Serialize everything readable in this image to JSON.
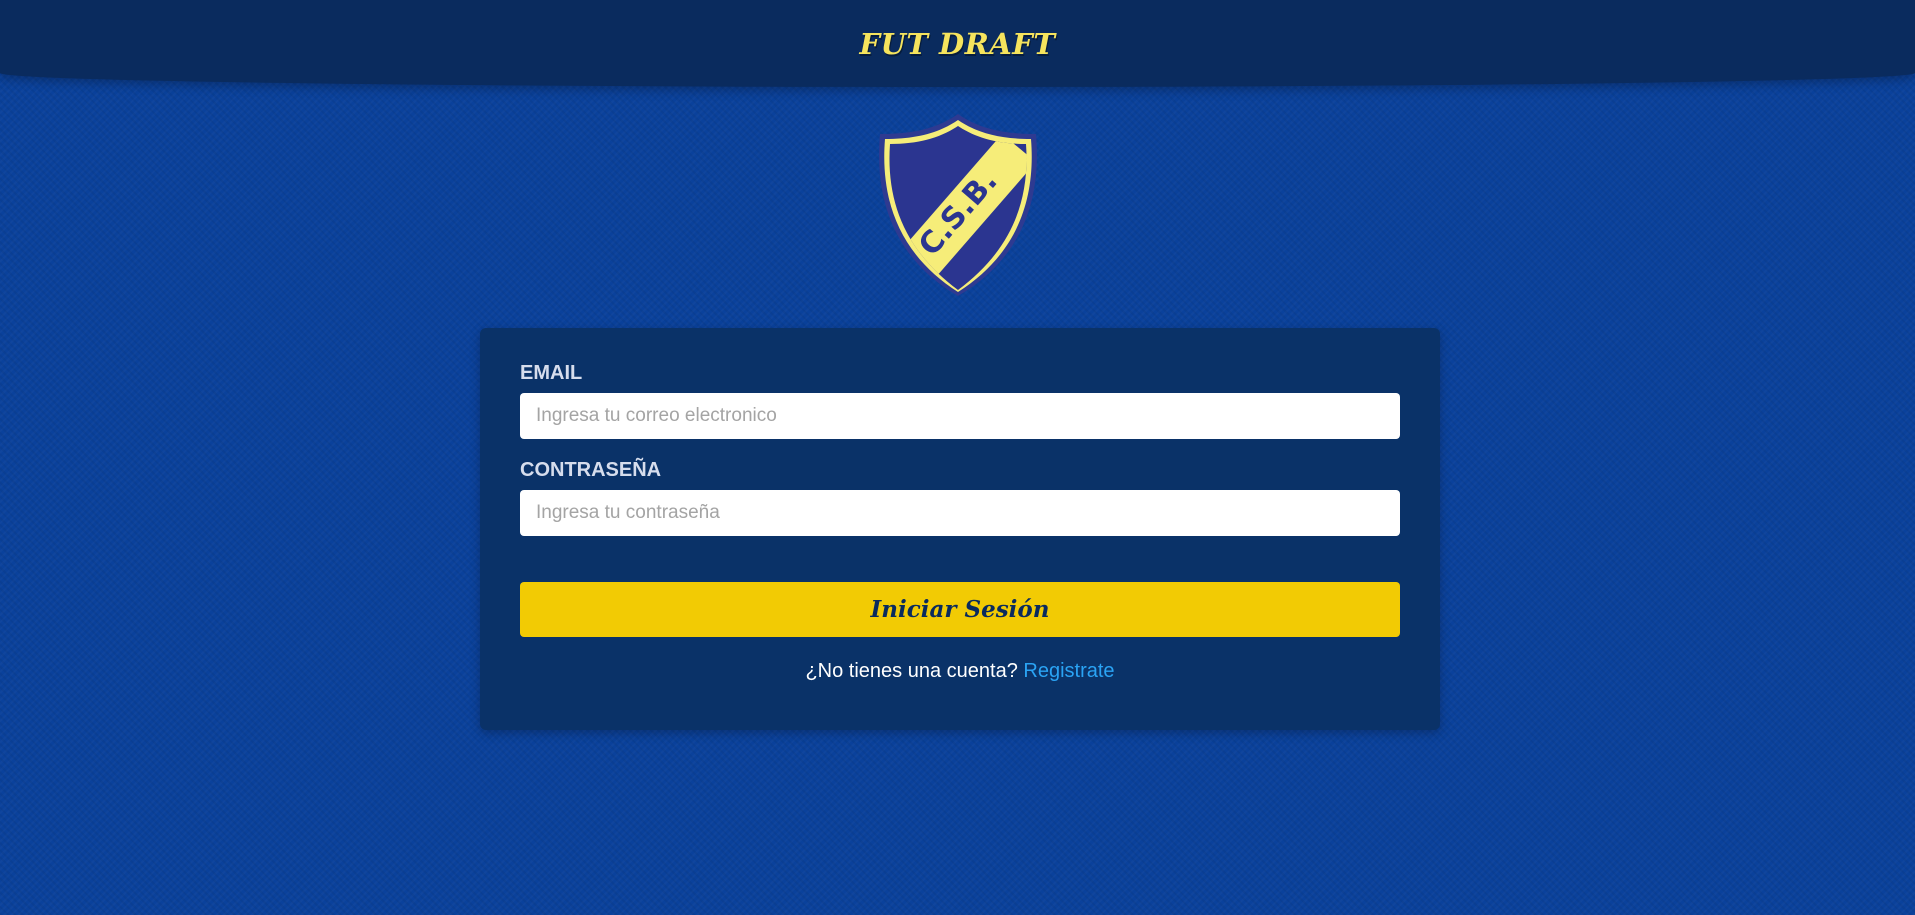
{
  "header": {
    "title": "FUT DRAFT"
  },
  "crest": {
    "text": "C.S.B.",
    "colors": {
      "shield_fill": "#2b3590",
      "band_and_border": "#f6ed79",
      "outline": "#2e3a91"
    }
  },
  "login_form": {
    "email": {
      "label": "EMAIL",
      "placeholder": "Ingresa tu correo electronico",
      "value": ""
    },
    "password": {
      "label": "CONTRASEÑA",
      "placeholder": "Ingresa tu contraseña",
      "value": ""
    },
    "submit_label": "Iniciar Sesión",
    "register_prompt": "¿No tienes una cuenta?",
    "register_link": "Registrate"
  },
  "colors": {
    "page_background": "#0a419b",
    "header_background": "#0a2b5e",
    "card_background": "#0a3268",
    "title_yellow": "#f6e45d",
    "button_yellow": "#f2cb04",
    "link_blue": "#2aa3f4"
  }
}
